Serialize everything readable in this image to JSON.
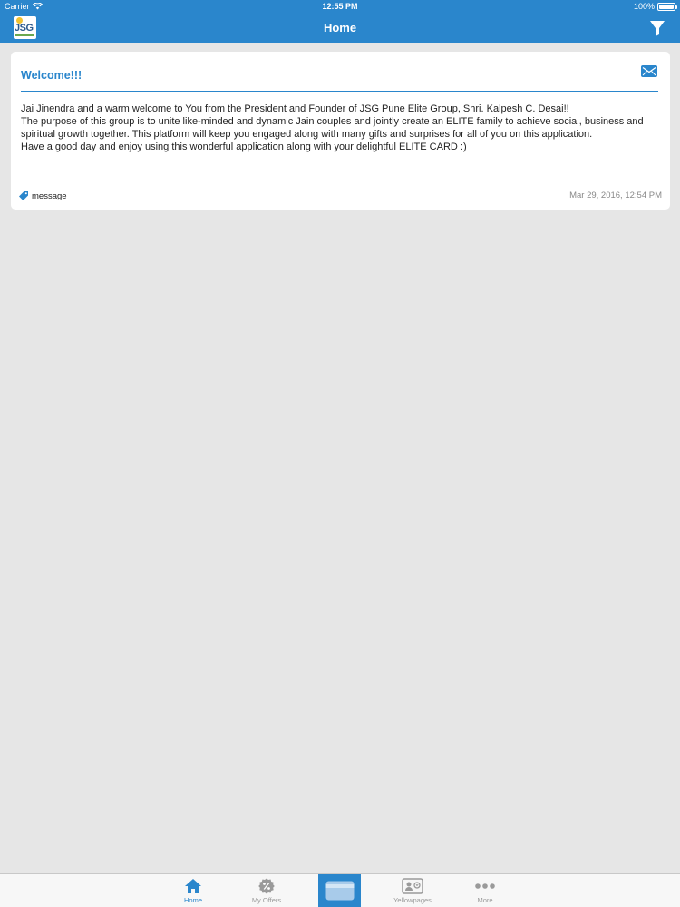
{
  "status_bar": {
    "carrier": "Carrier",
    "time": "12:55 PM",
    "battery": "100%"
  },
  "nav": {
    "title": "Home",
    "logo_text": "JSG"
  },
  "card": {
    "title": "Welcome!!!",
    "body": [
      "Jai Jinendra and a warm welcome to You from the President and Founder of JSG Pune Elite Group, Shri. Kalpesh C. Desai!!",
      "The purpose of this group is to unite like-minded and dynamic Jain couples and jointly create an ELITE family to achieve social, business and spiritual growth together. This platform will keep you engaged along with many gifts and surprises for all of you on this application.",
      "Have a good day and enjoy using this wonderful application along with your delightful ELITE CARD :)"
    ],
    "tag": "message",
    "timestamp": "Mar 29, 2016, 12:54 PM"
  },
  "tabs": [
    {
      "label": "Home",
      "icon": "home-icon",
      "active": true
    },
    {
      "label": "My Offers",
      "icon": "offers-icon",
      "active": false
    },
    {
      "label": "",
      "icon": "card-icon",
      "active": false
    },
    {
      "label": "Yellowpages",
      "icon": "yellowpages-icon",
      "active": false
    },
    {
      "label": "More",
      "icon": "more-icon",
      "active": false
    }
  ],
  "colors": {
    "accent": "#2a86cc",
    "background": "#e6e6e6",
    "card": "#ffffff",
    "tab_inactive": "#9a9a9a"
  }
}
